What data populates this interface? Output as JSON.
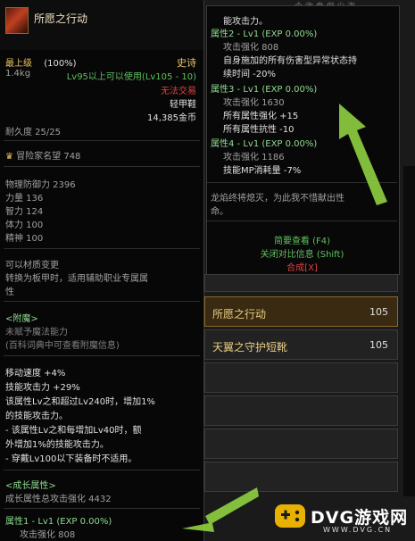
{
  "item": {
    "name": "所愿之行动",
    "level": "最上级",
    "percent": "(100%)",
    "rarity": "史诗",
    "weight": "1.4kg",
    "usable": "Lv95以上可以使用(Lv105 - 10)",
    "trade": "无法交易",
    "type": "轻甲鞋",
    "price": "14,385金币",
    "durability": "耐久度 25/25",
    "reputation": "冒险家名望 748",
    "stats": [
      "物理防御力 2396",
      "力量 136",
      "智力 124",
      "体力 100",
      "精神 100"
    ],
    "material_change": "可以材质变更",
    "material_desc": [
      "转换为板甲时，适用辅助职业专属属",
      "性"
    ],
    "enchant_title": "<附魔>",
    "enchant_lines": [
      "未赋予魔法能力",
      "(百科词典中可查看附魔信息)"
    ],
    "effects": [
      "移动速度 +4%",
      "技能攻击力 +29%",
      "该属性Lv之和超过Lv240时，增加1%",
      "的技能攻击力。",
      "- 该属性Lv之和每增加Lv40时，额",
      "外增加1%的技能攻击力。",
      "- 穿戴Lv100以下装备时不适用。"
    ],
    "growth_title": "<成长属性>",
    "growth_total": "成长属性总攻击强化 4432",
    "growth_attr1": "属性1 - Lv1 (EXP 0.00%)",
    "growth_attr1_sub": "攻击强化 808"
  },
  "right_tooltip": {
    "lines": [
      {
        "text": "能攻击力。",
        "color": "white"
      },
      {
        "text": "属性2 - Lv1 (EXP 0.00%)",
        "color": "lgreen"
      },
      {
        "text": "攻击强化 808",
        "color": "grey"
      },
      {
        "text": "自身施加的所有伤害型异常状态持",
        "color": "white"
      },
      {
        "text": "续时间 -20%",
        "color": "white"
      },
      {
        "text": "属性3 - Lv1 (EXP 0.00%)",
        "color": "lgreen"
      },
      {
        "text": "攻击强化 1630",
        "color": "grey"
      },
      {
        "text": "所有属性强化 +15",
        "color": "white"
      },
      {
        "text": "所有属性抗性 -10",
        "color": "white"
      },
      {
        "text": "属性4 - Lv1 (EXP 0.00%)",
        "color": "lgreen"
      },
      {
        "text": "攻击强化 1186",
        "color": "grey"
      },
      {
        "text": "技能MP消耗量 -7%",
        "color": "white"
      }
    ],
    "flavor": [
      "龙焰终将熄灭，为此我不惜献出性",
      "命。"
    ],
    "actions": [
      {
        "text": "简要查看 (F4)",
        "color": "green"
      },
      {
        "text": "关闭对比信息 (Shift)",
        "color": "green"
      },
      {
        "text": "合成[X]",
        "color": "red"
      }
    ]
  },
  "slots": [
    {
      "name": "所愿之行动",
      "value": "105"
    },
    {
      "name": "天翼之守护短靴",
      "value": "105"
    }
  ],
  "top_right_text": "个 收 盘 但 少 海",
  "watermark": {
    "main": "DVG游戏网",
    "sub": "WWW.DVG.CN"
  }
}
